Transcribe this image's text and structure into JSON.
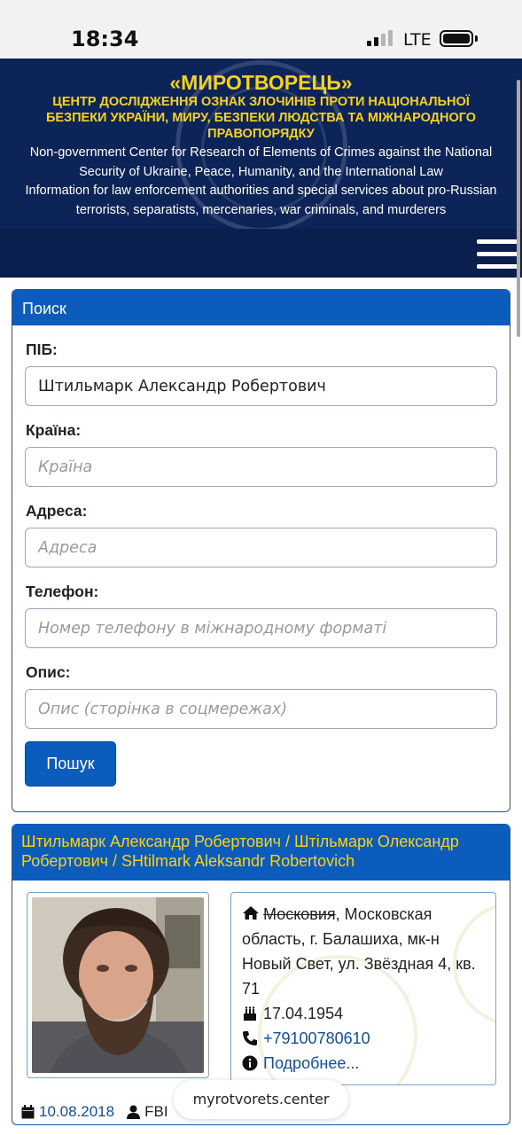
{
  "status_bar": {
    "time": "18:34",
    "network": "LTE"
  },
  "banner": {
    "title": "«МИРОТВОРЕЦЬ»",
    "subtitle": "ЦЕНТР ДОСЛІДЖЕННЯ ОЗНАК ЗЛОЧИНІВ ПРОТИ НАЦІОНАЛЬНОЇ БЕЗПЕКИ УКРАЇНИ, МИРУ, БЕЗПЕКИ ЛЮДСТВА ТА МІЖНАРОДНОГО ПРАВОПОРЯДКУ",
    "english_line1": "Non-government Center for Research of Elements of Crimes against the National Security of Ukraine, Peace, Humanity, and the International Law",
    "english_line2": "Information for law enforcement authorities and special services about pro-Russian terrorists, separatists, mercenaries, war criminals, and murderers"
  },
  "search": {
    "header": "Поиск",
    "fields": {
      "name": {
        "label": "ПІБ:",
        "value": "Штильмарк Александр Робертович",
        "placeholder": ""
      },
      "country": {
        "label": "Країна:",
        "value": "",
        "placeholder": "Країна"
      },
      "address": {
        "label": "Адреса:",
        "value": "",
        "placeholder": "Адреса"
      },
      "phone": {
        "label": "Телефон:",
        "value": "",
        "placeholder": "Номер телефону в міжнародному форматі"
      },
      "description": {
        "label": "Опис:",
        "value": "",
        "placeholder": "Опис (сторінка в соцмережах)"
      }
    },
    "button_label": "Пошук"
  },
  "result": {
    "name": "Штильмарк Александр Робертович / Штільмарк Олександр Робертович / SHtilmark Aleksandr Robertovich",
    "address_struck": "Московия",
    "address_rest": ", Московская область, г. Балашиха, мк-н Новый Свет, ул. Звёздная 4, кв. 71",
    "birthdate": "17.04.1954",
    "phone": "+79100780610",
    "more_link": "Подробнее...",
    "date_added": "10.08.2018",
    "source": "FBI"
  },
  "browser": {
    "url": "myrotvorets.center"
  },
  "colors": {
    "banner_bg": "#0c2457",
    "accent_blue": "#0b5cbd",
    "title_yellow": "#f7d21a"
  },
  "icons": [
    "signal-icon",
    "battery-icon",
    "menu-icon",
    "home-icon",
    "birthday-cake-icon",
    "phone-icon",
    "info-icon",
    "calendar-icon",
    "user-icon"
  ]
}
